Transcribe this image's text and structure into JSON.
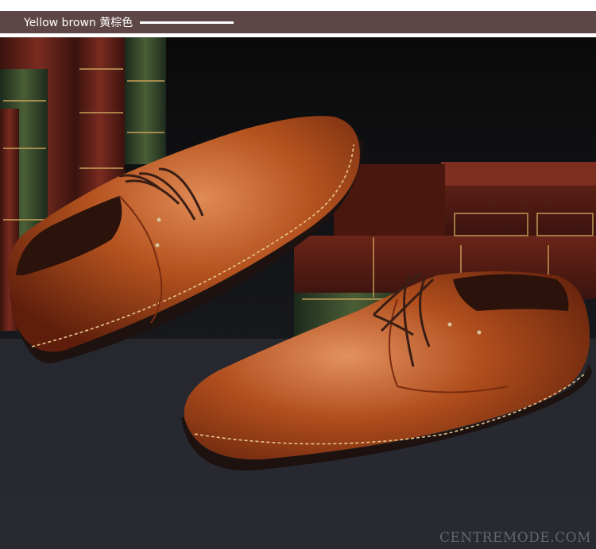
{
  "header": {
    "label": "Yellow brown 黄棕色",
    "bar_color": "#5e4646"
  },
  "photo": {
    "subject": "pair-of-brown-leather-oxford-shoes",
    "accent": "#a0451d"
  },
  "watermark": {
    "text": "CENTREMODE.COM"
  }
}
